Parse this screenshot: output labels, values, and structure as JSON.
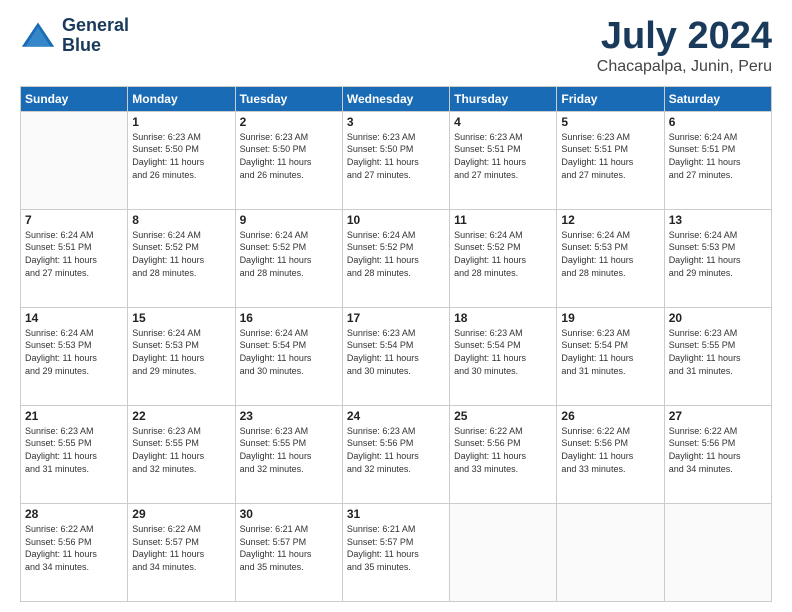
{
  "logo": {
    "line1": "General",
    "line2": "Blue"
  },
  "title": "July 2024",
  "subtitle": "Chacapalpa, Junin, Peru",
  "header_days": [
    "Sunday",
    "Monday",
    "Tuesday",
    "Wednesday",
    "Thursday",
    "Friday",
    "Saturday"
  ],
  "weeks": [
    [
      {
        "day": "",
        "info": ""
      },
      {
        "day": "1",
        "info": "Sunrise: 6:23 AM\nSunset: 5:50 PM\nDaylight: 11 hours\nand 26 minutes."
      },
      {
        "day": "2",
        "info": "Sunrise: 6:23 AM\nSunset: 5:50 PM\nDaylight: 11 hours\nand 26 minutes."
      },
      {
        "day": "3",
        "info": "Sunrise: 6:23 AM\nSunset: 5:50 PM\nDaylight: 11 hours\nand 27 minutes."
      },
      {
        "day": "4",
        "info": "Sunrise: 6:23 AM\nSunset: 5:51 PM\nDaylight: 11 hours\nand 27 minutes."
      },
      {
        "day": "5",
        "info": "Sunrise: 6:23 AM\nSunset: 5:51 PM\nDaylight: 11 hours\nand 27 minutes."
      },
      {
        "day": "6",
        "info": "Sunrise: 6:24 AM\nSunset: 5:51 PM\nDaylight: 11 hours\nand 27 minutes."
      }
    ],
    [
      {
        "day": "7",
        "info": "Sunrise: 6:24 AM\nSunset: 5:51 PM\nDaylight: 11 hours\nand 27 minutes."
      },
      {
        "day": "8",
        "info": "Sunrise: 6:24 AM\nSunset: 5:52 PM\nDaylight: 11 hours\nand 28 minutes."
      },
      {
        "day": "9",
        "info": "Sunrise: 6:24 AM\nSunset: 5:52 PM\nDaylight: 11 hours\nand 28 minutes."
      },
      {
        "day": "10",
        "info": "Sunrise: 6:24 AM\nSunset: 5:52 PM\nDaylight: 11 hours\nand 28 minutes."
      },
      {
        "day": "11",
        "info": "Sunrise: 6:24 AM\nSunset: 5:52 PM\nDaylight: 11 hours\nand 28 minutes."
      },
      {
        "day": "12",
        "info": "Sunrise: 6:24 AM\nSunset: 5:53 PM\nDaylight: 11 hours\nand 28 minutes."
      },
      {
        "day": "13",
        "info": "Sunrise: 6:24 AM\nSunset: 5:53 PM\nDaylight: 11 hours\nand 29 minutes."
      }
    ],
    [
      {
        "day": "14",
        "info": "Sunrise: 6:24 AM\nSunset: 5:53 PM\nDaylight: 11 hours\nand 29 minutes."
      },
      {
        "day": "15",
        "info": "Sunrise: 6:24 AM\nSunset: 5:53 PM\nDaylight: 11 hours\nand 29 minutes."
      },
      {
        "day": "16",
        "info": "Sunrise: 6:24 AM\nSunset: 5:54 PM\nDaylight: 11 hours\nand 30 minutes."
      },
      {
        "day": "17",
        "info": "Sunrise: 6:23 AM\nSunset: 5:54 PM\nDaylight: 11 hours\nand 30 minutes."
      },
      {
        "day": "18",
        "info": "Sunrise: 6:23 AM\nSunset: 5:54 PM\nDaylight: 11 hours\nand 30 minutes."
      },
      {
        "day": "19",
        "info": "Sunrise: 6:23 AM\nSunset: 5:54 PM\nDaylight: 11 hours\nand 31 minutes."
      },
      {
        "day": "20",
        "info": "Sunrise: 6:23 AM\nSunset: 5:55 PM\nDaylight: 11 hours\nand 31 minutes."
      }
    ],
    [
      {
        "day": "21",
        "info": "Sunrise: 6:23 AM\nSunset: 5:55 PM\nDaylight: 11 hours\nand 31 minutes."
      },
      {
        "day": "22",
        "info": "Sunrise: 6:23 AM\nSunset: 5:55 PM\nDaylight: 11 hours\nand 32 minutes."
      },
      {
        "day": "23",
        "info": "Sunrise: 6:23 AM\nSunset: 5:55 PM\nDaylight: 11 hours\nand 32 minutes."
      },
      {
        "day": "24",
        "info": "Sunrise: 6:23 AM\nSunset: 5:56 PM\nDaylight: 11 hours\nand 32 minutes."
      },
      {
        "day": "25",
        "info": "Sunrise: 6:22 AM\nSunset: 5:56 PM\nDaylight: 11 hours\nand 33 minutes."
      },
      {
        "day": "26",
        "info": "Sunrise: 6:22 AM\nSunset: 5:56 PM\nDaylight: 11 hours\nand 33 minutes."
      },
      {
        "day": "27",
        "info": "Sunrise: 6:22 AM\nSunset: 5:56 PM\nDaylight: 11 hours\nand 34 minutes."
      }
    ],
    [
      {
        "day": "28",
        "info": "Sunrise: 6:22 AM\nSunset: 5:56 PM\nDaylight: 11 hours\nand 34 minutes."
      },
      {
        "day": "29",
        "info": "Sunrise: 6:22 AM\nSunset: 5:57 PM\nDaylight: 11 hours\nand 34 minutes."
      },
      {
        "day": "30",
        "info": "Sunrise: 6:21 AM\nSunset: 5:57 PM\nDaylight: 11 hours\nand 35 minutes."
      },
      {
        "day": "31",
        "info": "Sunrise: 6:21 AM\nSunset: 5:57 PM\nDaylight: 11 hours\nand 35 minutes."
      },
      {
        "day": "",
        "info": ""
      },
      {
        "day": "",
        "info": ""
      },
      {
        "day": "",
        "info": ""
      }
    ]
  ]
}
